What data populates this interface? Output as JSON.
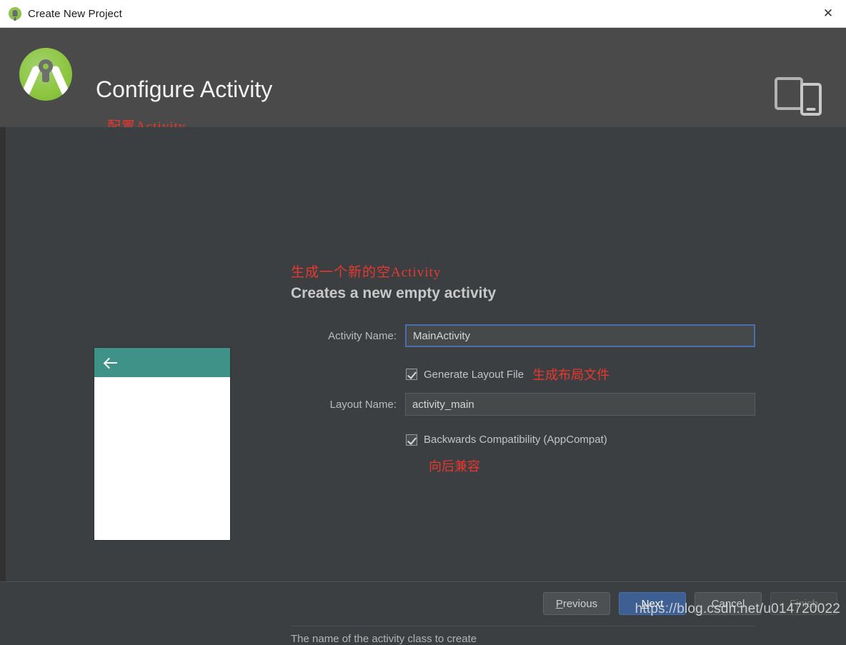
{
  "window": {
    "title": "Create New Project",
    "app_icon": "android-studio-icon",
    "close_icon": "close-icon"
  },
  "header": {
    "logo_icon": "android-studio-logo",
    "title": "Configure Activity",
    "annotation_cn": "配置Activity",
    "device_icon": "phone-tablet-icon"
  },
  "main": {
    "description_cn": "生成一个新的空Activity",
    "description_en": "Creates a new empty activity",
    "preview": {
      "back_icon": "back-arrow-icon",
      "appbar_color": "#3f9287",
      "body_color": "#ffffff"
    },
    "fields": {
      "activity_name": {
        "label": "Activity Name:",
        "value": "MainActivity",
        "focused": true
      },
      "generate_layout": {
        "label": "Generate Layout File",
        "checked": true,
        "annotation_cn": "生成布局文件"
      },
      "layout_name": {
        "label": "Layout Name:",
        "value": "activity_main",
        "focused": false
      },
      "backwards_compat": {
        "label": "Backwards Compatibility (AppCompat)",
        "checked": true,
        "annotation_cn": "向后兼容"
      }
    },
    "help_text": "The name of the activity class to create"
  },
  "footer": {
    "previous_label": "Previous",
    "next_label": "Next",
    "cancel_label": "Cancel",
    "finish_label": "Finish"
  },
  "watermark": "https://blog.csdn.net/u014720022",
  "colors": {
    "background": "#3c3f41",
    "header_band": "#4a4a4a",
    "accent_blue": "#4b6eaf",
    "annotation_red": "#e8382f",
    "preview_teal": "#3f9287"
  }
}
